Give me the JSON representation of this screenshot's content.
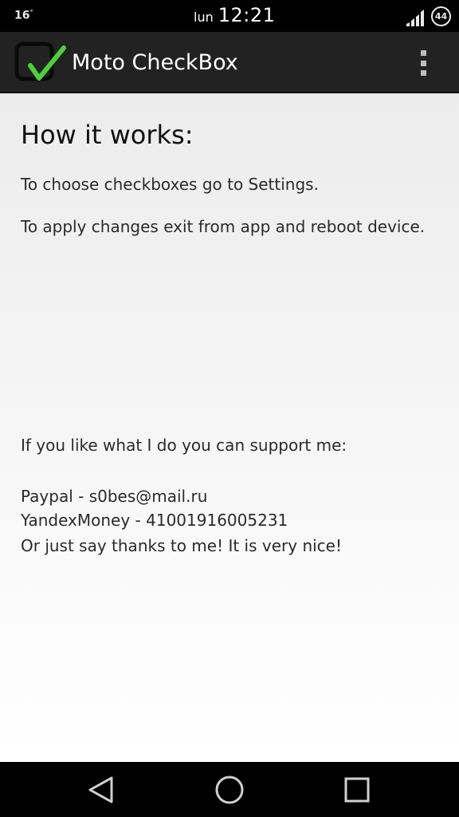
{
  "status_bar": {
    "temperature": "16",
    "temperature_unit": "°",
    "day": "lun",
    "time": "12:21",
    "battery": "44",
    "signal_icon": "signal-icon"
  },
  "action_bar": {
    "title": "Moto CheckBox",
    "app_icon": "checkbox-check-icon",
    "menu_icon": "overflow-menu-icon"
  },
  "main": {
    "heading": "How it works:",
    "instructions": [
      "To choose checkboxes go to Settings.",
      "To apply changes exit from app and reboot device."
    ],
    "support_intro": "If you like what I do you can support me:",
    "support_lines": [
      "Paypal - s0bes@mail.ru",
      "YandexMoney - 41001916005231",
      "Or just say thanks to me! It is very nice!"
    ]
  },
  "nav_bar": {
    "back_icon": "back-icon",
    "home_icon": "home-icon",
    "recents_icon": "recents-icon"
  },
  "colors": {
    "check_green": "#4cd137",
    "action_bar": "#222222"
  }
}
